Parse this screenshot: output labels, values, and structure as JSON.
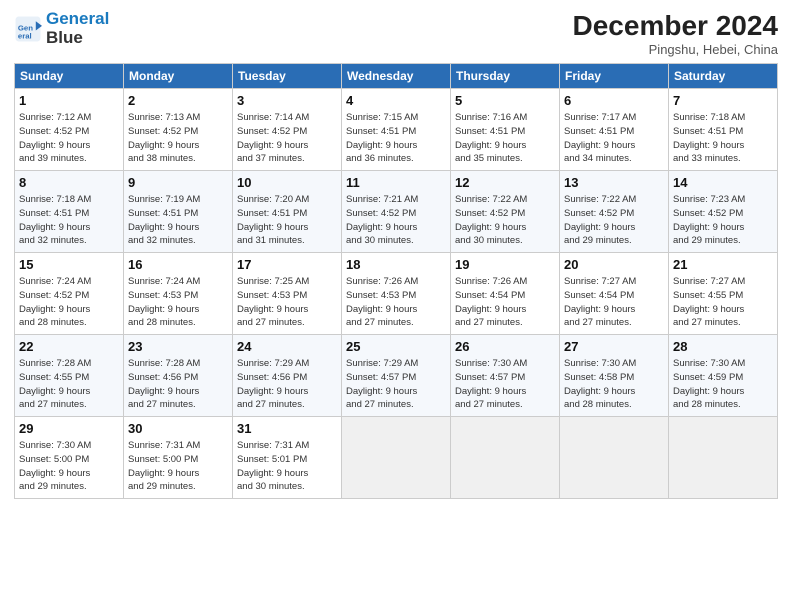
{
  "header": {
    "logo_line1": "General",
    "logo_line2": "Blue",
    "title": "December 2024",
    "subtitle": "Pingshu, Hebei, China"
  },
  "weekdays": [
    "Sunday",
    "Monday",
    "Tuesday",
    "Wednesday",
    "Thursday",
    "Friday",
    "Saturday"
  ],
  "weeks": [
    [
      {
        "day": "1",
        "sunrise": "7:12 AM",
        "sunset": "4:52 PM",
        "daylight": "9 hours and 39 minutes."
      },
      {
        "day": "2",
        "sunrise": "7:13 AM",
        "sunset": "4:52 PM",
        "daylight": "9 hours and 38 minutes."
      },
      {
        "day": "3",
        "sunrise": "7:14 AM",
        "sunset": "4:52 PM",
        "daylight": "9 hours and 37 minutes."
      },
      {
        "day": "4",
        "sunrise": "7:15 AM",
        "sunset": "4:51 PM",
        "daylight": "9 hours and 36 minutes."
      },
      {
        "day": "5",
        "sunrise": "7:16 AM",
        "sunset": "4:51 PM",
        "daylight": "9 hours and 35 minutes."
      },
      {
        "day": "6",
        "sunrise": "7:17 AM",
        "sunset": "4:51 PM",
        "daylight": "9 hours and 34 minutes."
      },
      {
        "day": "7",
        "sunrise": "7:18 AM",
        "sunset": "4:51 PM",
        "daylight": "9 hours and 33 minutes."
      }
    ],
    [
      {
        "day": "8",
        "sunrise": "7:18 AM",
        "sunset": "4:51 PM",
        "daylight": "9 hours and 32 minutes."
      },
      {
        "day": "9",
        "sunrise": "7:19 AM",
        "sunset": "4:51 PM",
        "daylight": "9 hours and 32 minutes."
      },
      {
        "day": "10",
        "sunrise": "7:20 AM",
        "sunset": "4:51 PM",
        "daylight": "9 hours and 31 minutes."
      },
      {
        "day": "11",
        "sunrise": "7:21 AM",
        "sunset": "4:52 PM",
        "daylight": "9 hours and 30 minutes."
      },
      {
        "day": "12",
        "sunrise": "7:22 AM",
        "sunset": "4:52 PM",
        "daylight": "9 hours and 30 minutes."
      },
      {
        "day": "13",
        "sunrise": "7:22 AM",
        "sunset": "4:52 PM",
        "daylight": "9 hours and 29 minutes."
      },
      {
        "day": "14",
        "sunrise": "7:23 AM",
        "sunset": "4:52 PM",
        "daylight": "9 hours and 29 minutes."
      }
    ],
    [
      {
        "day": "15",
        "sunrise": "7:24 AM",
        "sunset": "4:52 PM",
        "daylight": "9 hours and 28 minutes."
      },
      {
        "day": "16",
        "sunrise": "7:24 AM",
        "sunset": "4:53 PM",
        "daylight": "9 hours and 28 minutes."
      },
      {
        "day": "17",
        "sunrise": "7:25 AM",
        "sunset": "4:53 PM",
        "daylight": "9 hours and 27 minutes."
      },
      {
        "day": "18",
        "sunrise": "7:26 AM",
        "sunset": "4:53 PM",
        "daylight": "9 hours and 27 minutes."
      },
      {
        "day": "19",
        "sunrise": "7:26 AM",
        "sunset": "4:54 PM",
        "daylight": "9 hours and 27 minutes."
      },
      {
        "day": "20",
        "sunrise": "7:27 AM",
        "sunset": "4:54 PM",
        "daylight": "9 hours and 27 minutes."
      },
      {
        "day": "21",
        "sunrise": "7:27 AM",
        "sunset": "4:55 PM",
        "daylight": "9 hours and 27 minutes."
      }
    ],
    [
      {
        "day": "22",
        "sunrise": "7:28 AM",
        "sunset": "4:55 PM",
        "daylight": "9 hours and 27 minutes."
      },
      {
        "day": "23",
        "sunrise": "7:28 AM",
        "sunset": "4:56 PM",
        "daylight": "9 hours and 27 minutes."
      },
      {
        "day": "24",
        "sunrise": "7:29 AM",
        "sunset": "4:56 PM",
        "daylight": "9 hours and 27 minutes."
      },
      {
        "day": "25",
        "sunrise": "7:29 AM",
        "sunset": "4:57 PM",
        "daylight": "9 hours and 27 minutes."
      },
      {
        "day": "26",
        "sunrise": "7:30 AM",
        "sunset": "4:57 PM",
        "daylight": "9 hours and 27 minutes."
      },
      {
        "day": "27",
        "sunrise": "7:30 AM",
        "sunset": "4:58 PM",
        "daylight": "9 hours and 28 minutes."
      },
      {
        "day": "28",
        "sunrise": "7:30 AM",
        "sunset": "4:59 PM",
        "daylight": "9 hours and 28 minutes."
      }
    ],
    [
      {
        "day": "29",
        "sunrise": "7:30 AM",
        "sunset": "5:00 PM",
        "daylight": "9 hours and 29 minutes."
      },
      {
        "day": "30",
        "sunrise": "7:31 AM",
        "sunset": "5:00 PM",
        "daylight": "9 hours and 29 minutes."
      },
      {
        "day": "31",
        "sunrise": "7:31 AM",
        "sunset": "5:01 PM",
        "daylight": "9 hours and 30 minutes."
      },
      null,
      null,
      null,
      null
    ]
  ]
}
